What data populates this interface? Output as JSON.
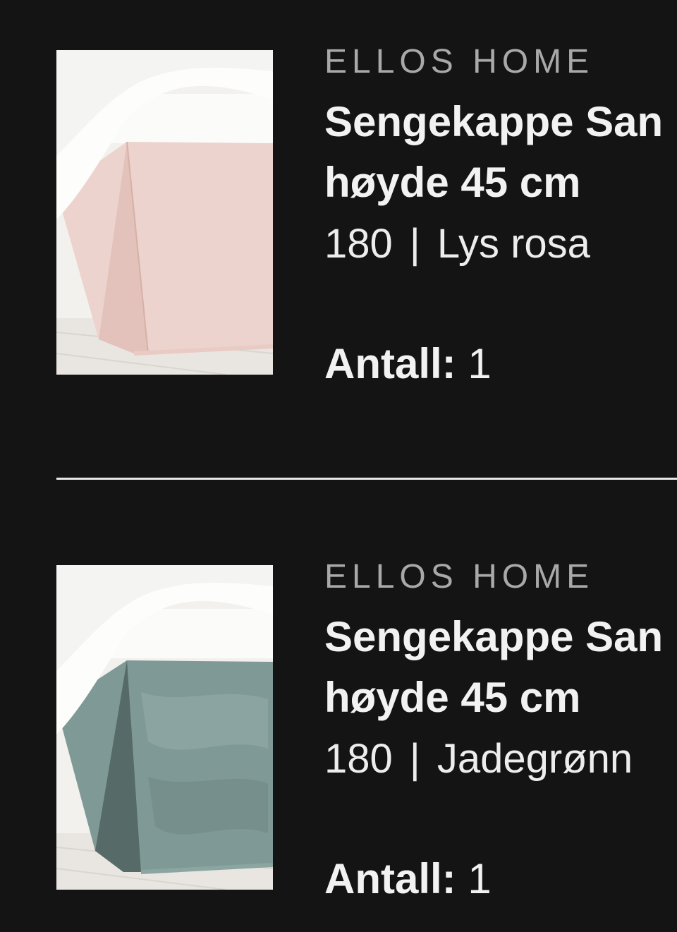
{
  "cart": {
    "items": [
      {
        "brand": "ELLOS HOME",
        "title_line1": "Sengekappe San",
        "title_line2": "høyde 45 cm",
        "size": "180",
        "separator": "|",
        "color_name": "Lys rosa",
        "quantity_label": "Antall:",
        "quantity": "1",
        "image_icon": "product-photo-bed-skirt",
        "skirt_color": "#ecd3cd"
      },
      {
        "brand": "ELLOS HOME",
        "title_line1": "Sengekappe San",
        "title_line2": "høyde 45 cm",
        "size": "180",
        "separator": "|",
        "color_name": "Jadegrønn",
        "quantity_label": "Antall:",
        "quantity": "1",
        "image_icon": "product-photo-bed-skirt",
        "skirt_color": "#7f9a96"
      }
    ]
  },
  "colors": {
    "background": "#141415",
    "brand_text": "#a9a9a9",
    "primary_text": "#f2f2f2",
    "divider": "#e8e8e8"
  }
}
